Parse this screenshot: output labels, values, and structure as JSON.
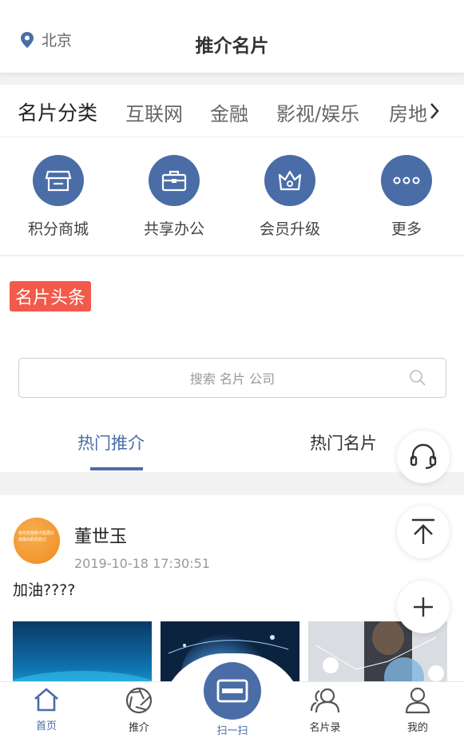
{
  "header": {
    "location": "北京",
    "title": "推介名片"
  },
  "categories": {
    "title": "名片分类",
    "items": [
      "互联网",
      "金融",
      "影视/娱乐",
      "房地"
    ]
  },
  "quick": [
    {
      "label": "积分商城",
      "icon": "shop-icon"
    },
    {
      "label": "共享办公",
      "icon": "briefcase-icon"
    },
    {
      "label": "会员升级",
      "icon": "crown-icon"
    },
    {
      "label": "更多",
      "icon": "more-icon"
    }
  ],
  "headline": {
    "tag": "名片头条"
  },
  "search": {
    "placeholder": "搜索 名片 公司"
  },
  "tabs": [
    "热门推介",
    "热门名片"
  ],
  "post": {
    "name": "董世玉",
    "time": "2019-10-18 17:30:51",
    "text": "加油????",
    "avatar_text": "有你支持我才能更好 做最出彩的自己"
  },
  "nav": [
    "首页",
    "推介",
    "扫一扫",
    "名片录",
    "我的"
  ],
  "colors": {
    "accent": "#4a6da7",
    "tag": "#f25a4a"
  }
}
